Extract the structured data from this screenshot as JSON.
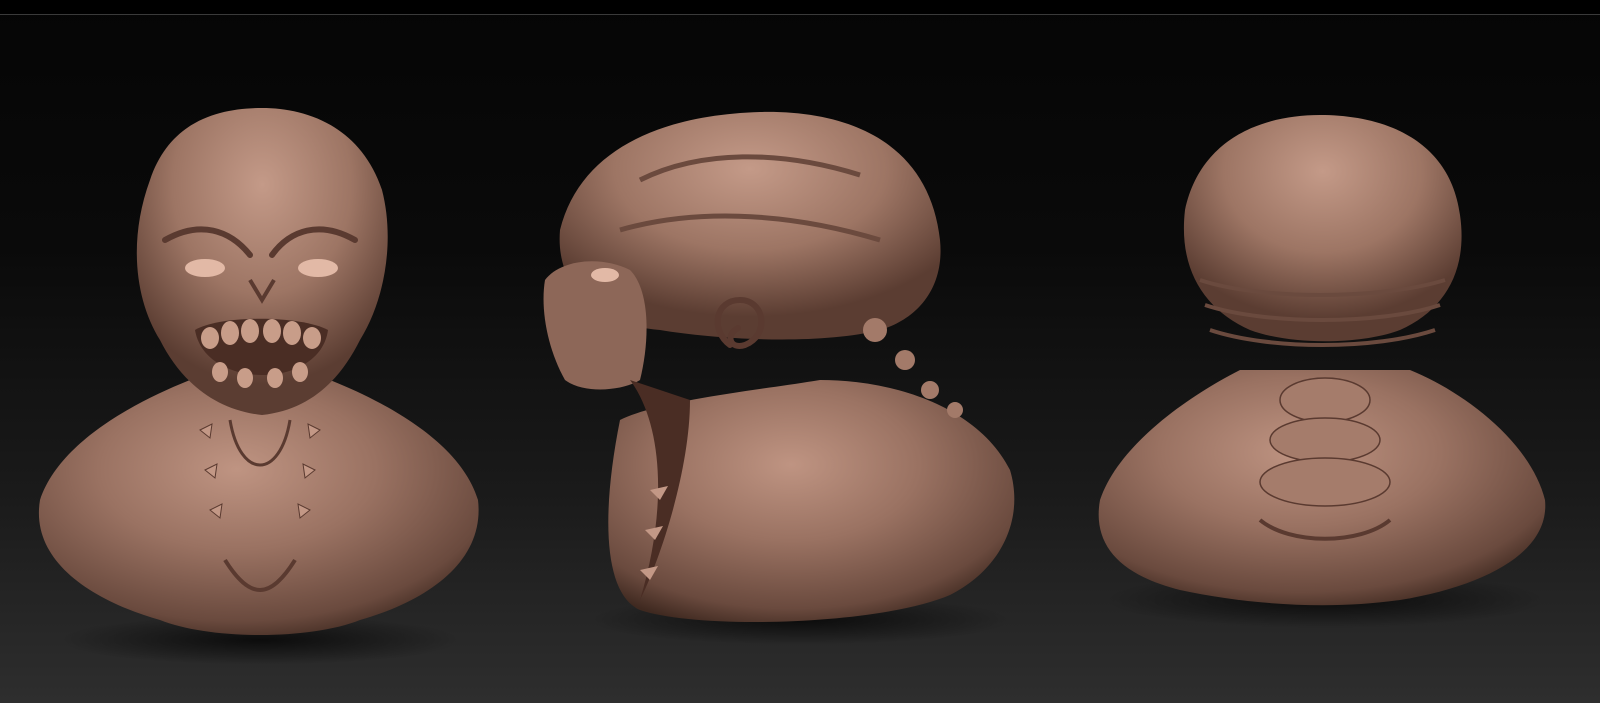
{
  "scene": {
    "views": [
      {
        "id": "front",
        "label": ""
      },
      {
        "id": "side",
        "label": ""
      },
      {
        "id": "back",
        "label": ""
      }
    ],
    "colors": {
      "clay_base": "#9a7262",
      "clay_light": "#b88f7e",
      "clay_shadow": "#4a2f26",
      "background_top": "#050505",
      "background_bottom": "#2e2e2e"
    }
  }
}
